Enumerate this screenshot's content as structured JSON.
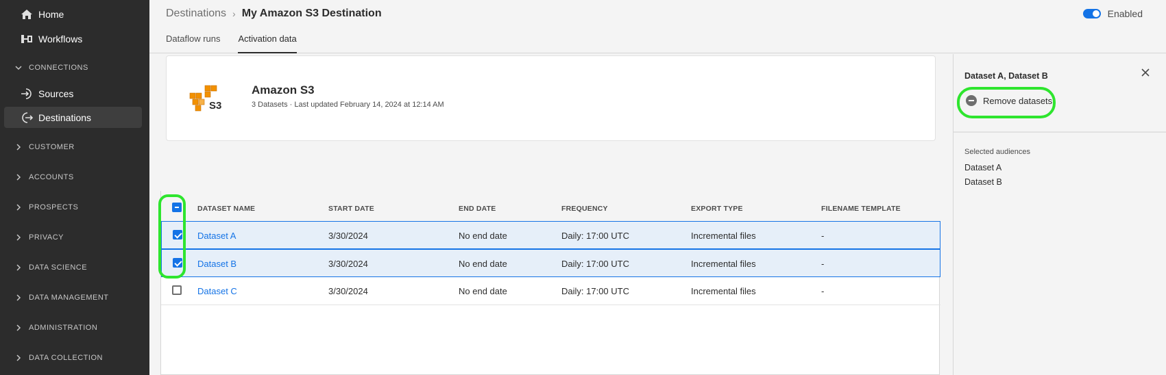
{
  "sidebar": {
    "top_items": [
      {
        "label": "Home",
        "icon": "home-icon"
      },
      {
        "label": "Workflows",
        "icon": "workflow-icon"
      }
    ],
    "connections_label": "CONNECTIONS",
    "connection_items": [
      {
        "label": "Sources",
        "icon": "sources-icon"
      },
      {
        "label": "Destinations",
        "icon": "destinations-icon",
        "active": true
      }
    ],
    "sections": [
      "CUSTOMER",
      "ACCOUNTS",
      "PROSPECTS",
      "PRIVACY",
      "DATA SCIENCE",
      "DATA MANAGEMENT",
      "ADMINISTRATION",
      "DATA COLLECTION"
    ]
  },
  "header": {
    "breadcrumb_root": "Destinations",
    "breadcrumb_current": "My Amazon S3 Destination",
    "toggle_label": "Enabled",
    "toggle_on": true,
    "tabs": [
      {
        "label": "Dataflow runs",
        "active": false
      },
      {
        "label": "Activation data",
        "active": true
      }
    ]
  },
  "card": {
    "logo_text": "S3",
    "title": "Amazon S3",
    "meta": "3 Datasets · Last updated February 14, 2024 at 12:14 AM"
  },
  "table": {
    "columns": [
      "DATASET NAME",
      "START DATE",
      "END DATE",
      "FREQUENCY",
      "EXPORT TYPE",
      "FILENAME TEMPLATE"
    ],
    "rows": [
      {
        "name": "Dataset A",
        "start": "3/30/2024",
        "end": "No end date",
        "frequency": "Daily: 17:00 UTC",
        "export": "Incremental files",
        "template": "-",
        "selected": true
      },
      {
        "name": "Dataset B",
        "start": "3/30/2024",
        "end": "No end date",
        "frequency": "Daily: 17:00 UTC",
        "export": "Incremental files",
        "template": "-",
        "selected": true
      },
      {
        "name": "Dataset C",
        "start": "3/30/2024",
        "end": "No end date",
        "frequency": "Daily: 17:00 UTC",
        "export": "Incremental files",
        "template": "-",
        "selected": false
      }
    ]
  },
  "panel": {
    "title": "Dataset A, Dataset B",
    "remove_label": "Remove datasets",
    "selected_label": "Selected audiences",
    "audiences": [
      "Dataset A",
      "Dataset B"
    ]
  },
  "colors": {
    "accent": "#1473e6",
    "highlight": "#2ee52e",
    "sidebar_bg": "#2c2c2c"
  }
}
